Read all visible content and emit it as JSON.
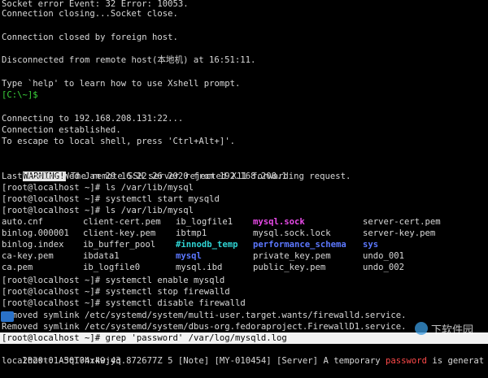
{
  "terminal": {
    "line_socket_error": "Socket error Event: 32 Error: 10053.",
    "line_conn_closing": "Connection closing...Socket close.",
    "line_closed_foreign": "Connection closed by foreign host.",
    "line_disconnected": "Disconnected from remote host(本地机) at 16:51:11.",
    "line_type_help": "Type `help' to learn how to use Xshell prompt.",
    "local_prompt": "[C:\\~]$",
    "line_connecting": "Connecting to 192.168.208.131:22...",
    "line_established": "Connection established.",
    "line_escape": "To escape to local shell, press 'Ctrl+Alt+]'.",
    "warning_label": "WARNING!",
    "warning_text": " The remote SSH server rejected X11 forwarding request.",
    "last_login": "Last login: Wed Jan 29 16:22:26 2020 from 192.168.208.1",
    "cmd1": "[root@localhost ~]# ls /var/lib/mysql",
    "cmd2": "[root@localhost ~]# systemctl start mysqld",
    "cmd3": "[root@localhost ~]# ls /var/lib/mysql",
    "listing": [
      [
        "auto.cnf",
        "client-cert.pem",
        "ib_logfile1",
        "mysql.sock",
        "server-cert.pem"
      ],
      [
        "binlog.000001",
        "client-key.pem",
        "ibtmp1",
        "mysql.sock.lock",
        "server-key.pem"
      ],
      [
        "binlog.index",
        "ib_buffer_pool",
        "#innodb_temp",
        "performance_schema",
        "sys"
      ],
      [
        "ca-key.pem",
        "ibdata1",
        "mysql",
        "private_key.pem",
        "undo_001"
      ],
      [
        "ca.pem",
        "ib_logfile0",
        "mysql.ibd",
        "public_key.pem",
        "undo_002"
      ]
    ],
    "cmd4": "[root@localhost ~]# systemctl enable mysqld",
    "cmd5": "[root@localhost ~]# systemctl stop firewalld",
    "cmd6": "[root@localhost ~]# systemctl disable firewalld",
    "removed1": "Removed symlink /etc/systemd/system/multi-user.target.wants/firewalld.service.",
    "removed2": "Removed symlink /etc/systemd/system/dbus-org.fedoraproject.FirewallD1.service.",
    "cmd_grep": "[root@localhost ~]# grep 'password' /var/log/mysqld.log",
    "log_prefix": "2020-01-30T04:49:43.872677Z 5 [Note] [MY-010454] [Server] A temporary ",
    "log_keyword": "password",
    "log_suffix": " is generat",
    "log_line2": "localhost: A5qi?hxkwjyq"
  },
  "watermark": {
    "text": "下软件园"
  },
  "colors": {
    "background": "#000000",
    "text": "#d8d8d8",
    "prompt_green": "#3cd53c",
    "dir_blue": "#5c78ff",
    "socket_magenta": "#e84ae8",
    "cyan": "#2fd3d3",
    "grep_match_red": "#ff4a4a"
  }
}
